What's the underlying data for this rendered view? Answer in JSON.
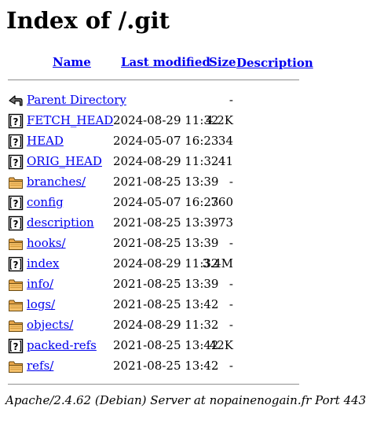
{
  "title": "Index of /.git",
  "columns": {
    "name": "Name",
    "last_modified": "Last modified",
    "size": "Size",
    "description": "Description"
  },
  "entries": [
    {
      "icon": "back-icon",
      "name": "Parent Directory",
      "modified": "",
      "size": "-",
      "description": ""
    },
    {
      "icon": "unknown-icon",
      "name": "FETCH_HEAD",
      "modified": "2024-08-29 11:32",
      "size": "4.2K",
      "description": ""
    },
    {
      "icon": "unknown-icon",
      "name": "HEAD",
      "modified": "2024-05-07 16:23",
      "size": "34",
      "description": ""
    },
    {
      "icon": "unknown-icon",
      "name": "ORIG_HEAD",
      "modified": "2024-08-29 11:32",
      "size": "41",
      "description": ""
    },
    {
      "icon": "folder-icon",
      "name": "branches/",
      "modified": "2021-08-25 13:39",
      "size": "-",
      "description": ""
    },
    {
      "icon": "unknown-icon",
      "name": "config",
      "modified": "2024-05-07 16:23",
      "size": "760",
      "description": ""
    },
    {
      "icon": "unknown-icon",
      "name": "description",
      "modified": "2021-08-25 13:39",
      "size": "73",
      "description": ""
    },
    {
      "icon": "folder-icon",
      "name": "hooks/",
      "modified": "2021-08-25 13:39",
      "size": "-",
      "description": ""
    },
    {
      "icon": "unknown-icon",
      "name": "index",
      "modified": "2024-08-29 11:32",
      "size": "3.4M",
      "description": ""
    },
    {
      "icon": "folder-icon",
      "name": "info/",
      "modified": "2021-08-25 13:39",
      "size": "-",
      "description": ""
    },
    {
      "icon": "folder-icon",
      "name": "logs/",
      "modified": "2021-08-25 13:42",
      "size": "-",
      "description": ""
    },
    {
      "icon": "folder-icon",
      "name": "objects/",
      "modified": "2024-08-29 11:32",
      "size": "-",
      "description": ""
    },
    {
      "icon": "unknown-icon",
      "name": "packed-refs",
      "modified": "2021-08-25 13:42",
      "size": "42K",
      "description": ""
    },
    {
      "icon": "folder-icon",
      "name": "refs/",
      "modified": "2021-08-25 13:42",
      "size": "-",
      "description": ""
    }
  ],
  "footer": "Apache/2.4.62 (Debian) Server at nopainenogain.fr Port 443"
}
